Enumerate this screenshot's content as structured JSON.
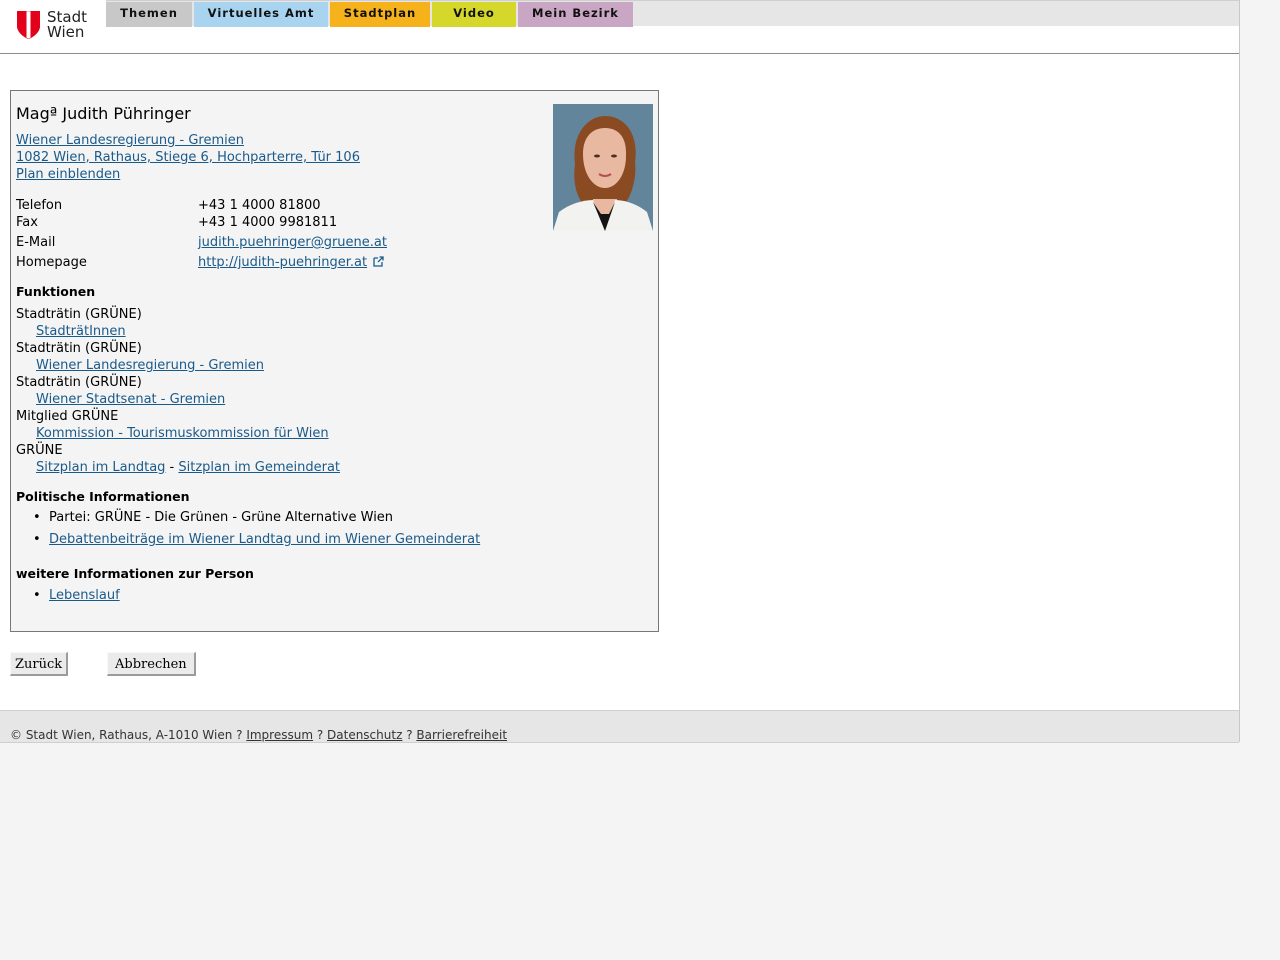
{
  "header": {
    "logo_text_line1": "Stadt",
    "logo_text_line2": "Wien",
    "nav": [
      {
        "label": "Themen",
        "color": "#c8c8c8"
      },
      {
        "label": "Virtuelles Amt",
        "color": "#a8d4f0"
      },
      {
        "label": "Stadtplan",
        "color": "#f5b21b"
      },
      {
        "label": "Video",
        "color": "#d5d82b"
      },
      {
        "label": "Mein Bezirk",
        "color": "#c9a6c3"
      }
    ]
  },
  "person": {
    "name": "Magª Judith Pühringer",
    "org_link": "Wiener Landesregierung - Gremien ",
    "address_link": "1082 Wien, Rathaus, Stiege 6, Hochparterre, Tür 106",
    "plan_link": "Plan einblenden",
    "contact": {
      "telefon_label": "Telefon",
      "telefon": "+43 1 4000 81800",
      "fax_label": "Fax",
      "fax": "+43 1 4000 9981811",
      "email_label": "E-Mail",
      "email": "judith.puehringer@gruene.at",
      "homepage_label": "Homepage",
      "homepage": "http://judith-puehringer.at"
    }
  },
  "funktionen": {
    "heading": "Funktionen",
    "items": [
      {
        "role": "Stadträtin (GRÜNE)",
        "link": "StadträtInnen"
      },
      {
        "role": "Stadträtin (GRÜNE)",
        "link": "Wiener Landesregierung - Gremien"
      },
      {
        "role": "Stadträtin (GRÜNE)",
        "link": "Wiener Stadtsenat - Gremien"
      },
      {
        "role": "Mitglied GRÜNE",
        "link": "Kommission - Tourismuskommission für Wien"
      }
    ],
    "party": "GRÜNE",
    "sitzplan_landtag": "Sitzplan im Landtag",
    "separator": " - ",
    "sitzplan_gemeinderat": "Sitzplan im Gemeinderat"
  },
  "politisch": {
    "heading": "Politische Informationen",
    "partei": "Partei: GRÜNE - Die Grünen - Grüne Alternative Wien",
    "debatten_link": "Debattenbeiträge im Wiener Landtag und im Wiener Gemeinderat"
  },
  "weitere": {
    "heading": "weitere Informationen zur Person",
    "lebenslauf_link": "Lebenslauf"
  },
  "buttons": {
    "back": "Zurück",
    "cancel": "Abbrechen"
  },
  "footer": {
    "copyright": "© Stadt Wien, Rathaus, A-1010 Wien ? ",
    "impressum": "Impressum",
    "sep1": " ? ",
    "datenschutz": "Datenschutz",
    "sep2": " ? ",
    "barrierefreiheit": "Barrierefreiheit"
  },
  "colors": {
    "link": "#1a5a8a",
    "logo_red": "#e2001a"
  }
}
